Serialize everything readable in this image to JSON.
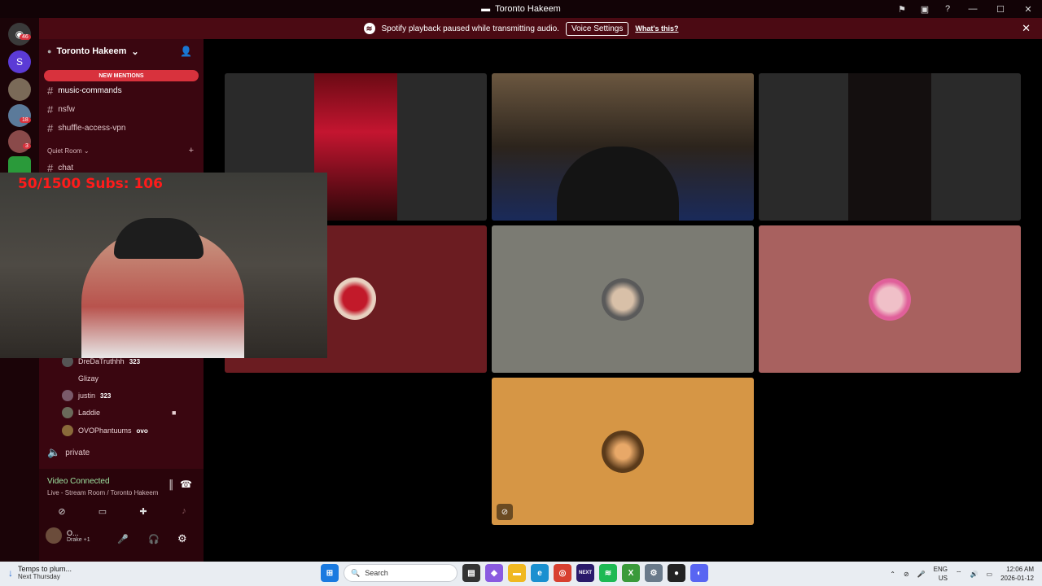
{
  "window": {
    "title": "Toronto Hakeem"
  },
  "banner": {
    "message": "Spotify playback paused while transmitting audio.",
    "button": "Voice Settings",
    "link": "What's this?"
  },
  "guilds": {
    "badge_top": "46",
    "badge_mid": "18",
    "badge_low": "3"
  },
  "server": {
    "name": "Toronto Hakeem",
    "new_mentions": "NEW MENTIONS",
    "channels": [
      "music-commands",
      "nsfw",
      "shuffle-access-vpn"
    ],
    "category": "Quiet Room",
    "quiet_channels": [
      "chat"
    ],
    "voice_members": [
      {
        "name": "DreDaTruthhh",
        "badge": "323"
      },
      {
        "name": "Glizay",
        "badge": ""
      },
      {
        "name": "justin",
        "badge": "323"
      },
      {
        "name": "Laddie",
        "badge": ""
      },
      {
        "name": "OVOPhantuums",
        "badge": "ovo"
      }
    ],
    "voice_channel_private": "private"
  },
  "stream_overlay": {
    "text": "50/1500  Subs: 106"
  },
  "voice_connection": {
    "status": "Video Connected",
    "location": "Live - Stream Room / Toronto Hakeem"
  },
  "user_panel": {
    "name": "O...",
    "activity": "Drake +1"
  },
  "taskbar": {
    "weather_title": "Temps to plum...",
    "weather_sub": "Next Thursday",
    "search_placeholder": "Search",
    "lang": "ENG",
    "region": "US",
    "time": "12:06 AM",
    "date": "2026-01-12"
  },
  "colors": {
    "tile_red": "#6b1c21",
    "tile_gray": "#7b7b73",
    "tile_pink": "#a8615f",
    "tile_orange": "#d69645",
    "sidebar": "#3a0610",
    "mentions": "#d8323d"
  }
}
